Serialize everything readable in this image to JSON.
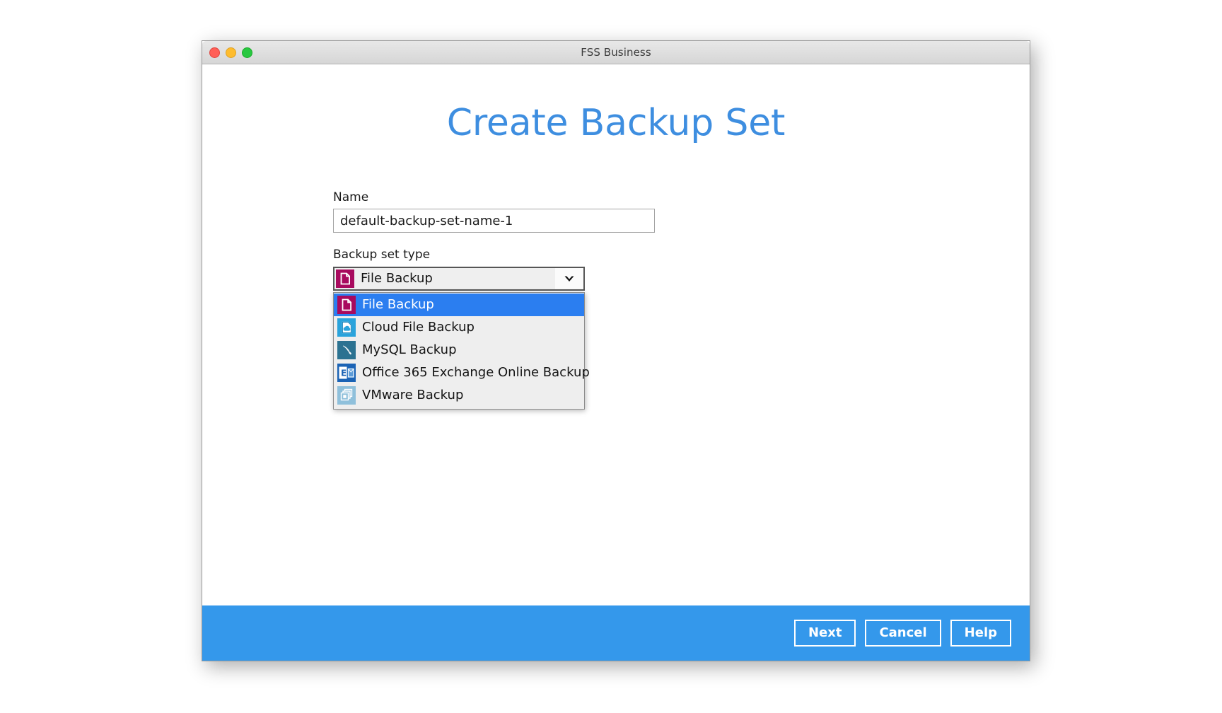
{
  "window": {
    "title": "FSS Business",
    "traffic_lights": [
      {
        "name": "close",
        "color": "#ff5f57"
      },
      {
        "name": "minimize",
        "color": "#febc2e"
      },
      {
        "name": "zoom",
        "color": "#28c840"
      }
    ]
  },
  "page": {
    "title": "Create Backup Set",
    "title_color": "#3e8ee0"
  },
  "form": {
    "name": {
      "label": "Name",
      "value": "default-backup-set-name-1",
      "placeholder": "default-backup-set-name-1"
    },
    "backup_set_type": {
      "label": "Backup set type",
      "selected": "File Backup",
      "selected_icon": "file-backup-icon",
      "expanded": true,
      "options": [
        {
          "label": "File Backup",
          "icon": "file-backup-icon",
          "selected": true
        },
        {
          "label": "Cloud File Backup",
          "icon": "cloud-file-backup-icon",
          "selected": false
        },
        {
          "label": "MySQL Backup",
          "icon": "mysql-backup-icon",
          "selected": false
        },
        {
          "label": "Office 365 Exchange Online Backup",
          "icon": "office365-exchange-icon",
          "selected": false
        },
        {
          "label": "VMware Backup",
          "icon": "vmware-backup-icon",
          "selected": false
        }
      ]
    }
  },
  "footer": {
    "background": "#3498eb",
    "buttons": [
      {
        "label": "Next",
        "name": "next-button"
      },
      {
        "label": "Cancel",
        "name": "cancel-button"
      },
      {
        "label": "Help",
        "name": "help-button"
      }
    ]
  },
  "colors": {
    "accent_blue": "#3498eb",
    "highlight_blue": "#2b7ef0",
    "file_backup_magenta": "#a80a5e",
    "cloud_blue": "#29a3dc",
    "mysql_teal": "#2b7291",
    "office_blue": "#1b63b5",
    "vmware_light_blue": "#8fc0db"
  }
}
